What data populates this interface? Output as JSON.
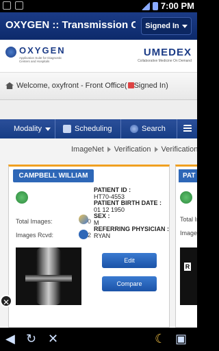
{
  "status_bar": {
    "time": "7:00 PM",
    "icons": [
      "usb-icon",
      "image-icon",
      "signal-icon",
      "battery-icon"
    ]
  },
  "app": {
    "title": "OXYGEN :: Transmission C...",
    "signed_in_label": "Signed In"
  },
  "logos": {
    "oxygen_name": "OXYGEN",
    "oxygen_tagline": "Application Suite for Diagnostic Centers and Hospitals",
    "umedex_name": "UMEDEX",
    "umedex_tagline": "Collaborative Medicine On Demand"
  },
  "welcome": {
    "text": "Welcome, oxyfront - Front Office(",
    "status": "Signed In)"
  },
  "nav": {
    "modality": "Modality",
    "scheduling": "Scheduling",
    "search": "Search"
  },
  "breadcrumb": [
    "ImageNet",
    "Verification",
    "Verification"
  ],
  "cards": [
    {
      "name": "CAMPBELL WILLIAM",
      "total_images_label": "Total Images:",
      "total_images": "0",
      "images_rcvd_label": "Images Rcvd:",
      "images_rcvd": "2",
      "patient_id_label": "PATIENT ID :",
      "patient_id": "HT70-4553",
      "birth_date_label": "PATIENT BIRTH DATE :",
      "birth_date": "01 12 1950",
      "sex_label": "SEX :",
      "sex": "M",
      "referring_label": "REFERRING PHYSICIAN :",
      "referring": "RYAN",
      "edit_label": "Edit",
      "compare_label": "Compare"
    },
    {
      "name_partial": "PAT",
      "total_images_label": "Total Images:",
      "images_rcvd_label": "Images Rcvd:",
      "thumb_marker": "R"
    }
  ],
  "colors": {
    "header_blue": "#1b3b86",
    "nav_blue": "#173d85",
    "card_accent": "#f0a020",
    "button_blue": "#2e67b7"
  }
}
